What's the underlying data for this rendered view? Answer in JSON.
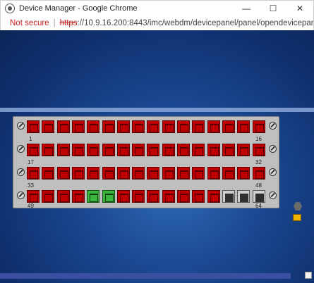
{
  "window": {
    "title": "Device Manager - Google Chrome",
    "controls": {
      "minimize": "—",
      "maximize": "☐",
      "close": "✕"
    }
  },
  "address": {
    "security_label": "Not secure",
    "separator": "|",
    "protocol": "https",
    "url_rest": "://10.9.16.200:8443/imc/webdm/devicepanel/panel/opendevicepanel..."
  },
  "panel": {
    "port_labels": {
      "r1": "1",
      "r1_end": "16",
      "r2": "17",
      "r2_end": "32",
      "r3": "33",
      "r3_end": "48",
      "r4": "49",
      "r4_end": "64"
    },
    "rows": [
      {
        "ports": [
          "down",
          "down",
          "down",
          "down",
          "down",
          "down",
          "down",
          "down",
          "down",
          "down",
          "down",
          "down",
          "down",
          "down",
          "down",
          "down"
        ]
      },
      {
        "ports": [
          "down",
          "down",
          "down",
          "down",
          "down",
          "down",
          "down",
          "down",
          "down",
          "down",
          "down",
          "down",
          "down",
          "down",
          "down",
          "down"
        ]
      },
      {
        "ports": [
          "down",
          "down",
          "down",
          "down",
          "down",
          "down",
          "down",
          "down",
          "down",
          "down",
          "down",
          "down",
          "down",
          "down",
          "down",
          "down"
        ]
      },
      {
        "ports": [
          "down",
          "down",
          "down",
          "down",
          "up",
          "up",
          "down",
          "down",
          "down",
          "down",
          "down",
          "down",
          "down",
          "empty",
          "empty",
          "empty"
        ]
      }
    ],
    "status_colors": {
      "down": "#c00000",
      "up": "#3bb53b",
      "empty": "#cfcfcf"
    }
  },
  "icons": {
    "app": "chrome-app-icon",
    "warning": "warning-icon",
    "screw": "screw-icon",
    "hex": "settings-hex-icon",
    "alert": "alert-badge-icon"
  }
}
